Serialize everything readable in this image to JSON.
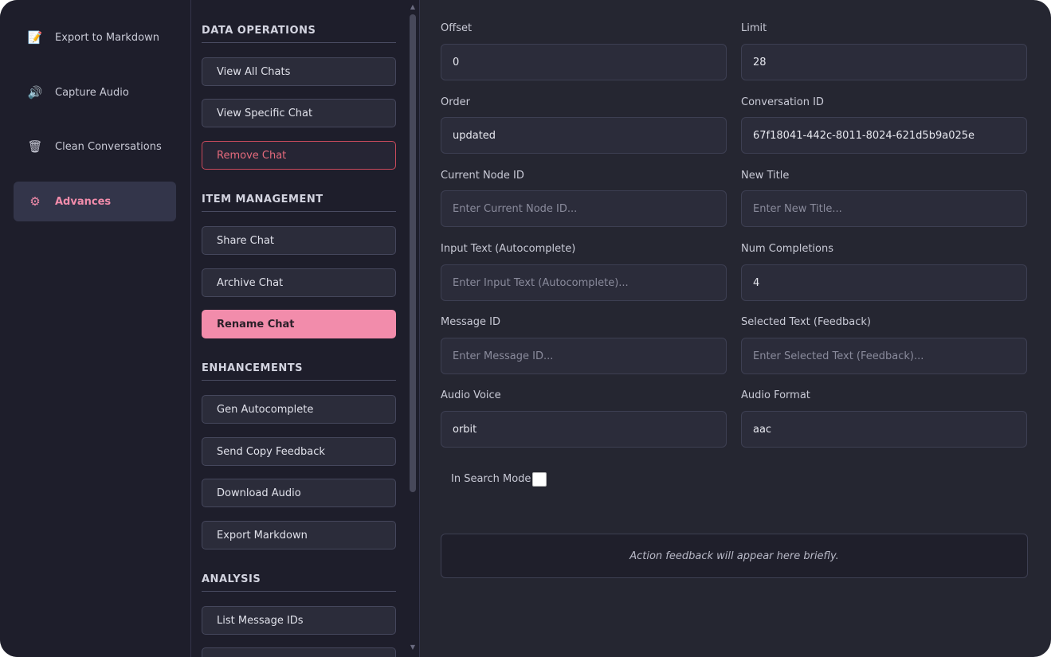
{
  "nav": {
    "items": [
      {
        "label": "Export to Markdown",
        "icon": "memo-icon",
        "glyph": "📝",
        "active": false
      },
      {
        "label": "Capture Audio",
        "icon": "speaker-icon",
        "glyph": "🔊",
        "active": false
      },
      {
        "label": "Clean Conversations",
        "icon": "wastebasket-icon",
        "glyph": "🗑",
        "active": false
      },
      {
        "label": "Advances",
        "icon": "gear-icon",
        "glyph": "⚙",
        "active": true
      }
    ]
  },
  "sections": {
    "data_operations": {
      "title": "DATA OPERATIONS",
      "buttons": [
        "View All Chats",
        "View Specific Chat",
        "Remove Chat"
      ]
    },
    "item_management": {
      "title": "ITEM MANAGEMENT",
      "buttons": [
        "Share Chat",
        "Archive Chat",
        "Rename Chat"
      ]
    },
    "enhancements": {
      "title": "ENHANCEMENTS",
      "buttons": [
        "Gen Autocomplete",
        "Send Copy Feedback",
        "Download Audio",
        "Export Markdown"
      ]
    },
    "analysis": {
      "title": "ANALYSIS",
      "buttons": [
        "List Message IDs"
      ]
    }
  },
  "form": {
    "offset": {
      "label": "Offset",
      "value": "0",
      "placeholder": ""
    },
    "limit": {
      "label": "Limit",
      "value": "28",
      "placeholder": ""
    },
    "order": {
      "label": "Order",
      "value": "updated",
      "placeholder": ""
    },
    "conversation_id": {
      "label": "Conversation ID",
      "value": "67f18041-442c-8011-8024-621d5b9a025e",
      "placeholder": ""
    },
    "current_node_id": {
      "label": "Current Node ID",
      "value": "",
      "placeholder": "Enter Current Node ID..."
    },
    "new_title": {
      "label": "New Title",
      "value": "",
      "placeholder": "Enter New Title..."
    },
    "input_text": {
      "label": "Input Text (Autocomplete)",
      "value": "",
      "placeholder": "Enter Input Text (Autocomplete)..."
    },
    "num_completions": {
      "label": "Num Completions",
      "value": "4",
      "placeholder": ""
    },
    "message_id": {
      "label": "Message ID",
      "value": "",
      "placeholder": "Enter Message ID..."
    },
    "selected_text": {
      "label": "Selected Text (Feedback)",
      "value": "",
      "placeholder": "Enter Selected Text (Feedback)..."
    },
    "audio_voice": {
      "label": "Audio Voice",
      "value": "orbit",
      "placeholder": ""
    },
    "audio_format": {
      "label": "Audio Format",
      "value": "aac",
      "placeholder": ""
    },
    "search_mode": {
      "label": "In Search Mode",
      "checked": false
    }
  },
  "feedback": {
    "text": "Action feedback will appear here briefly."
  },
  "colors": {
    "accent": "#f28cab",
    "danger": "#e46a7c",
    "background": "#252631",
    "panel": "#1e1e2b"
  }
}
